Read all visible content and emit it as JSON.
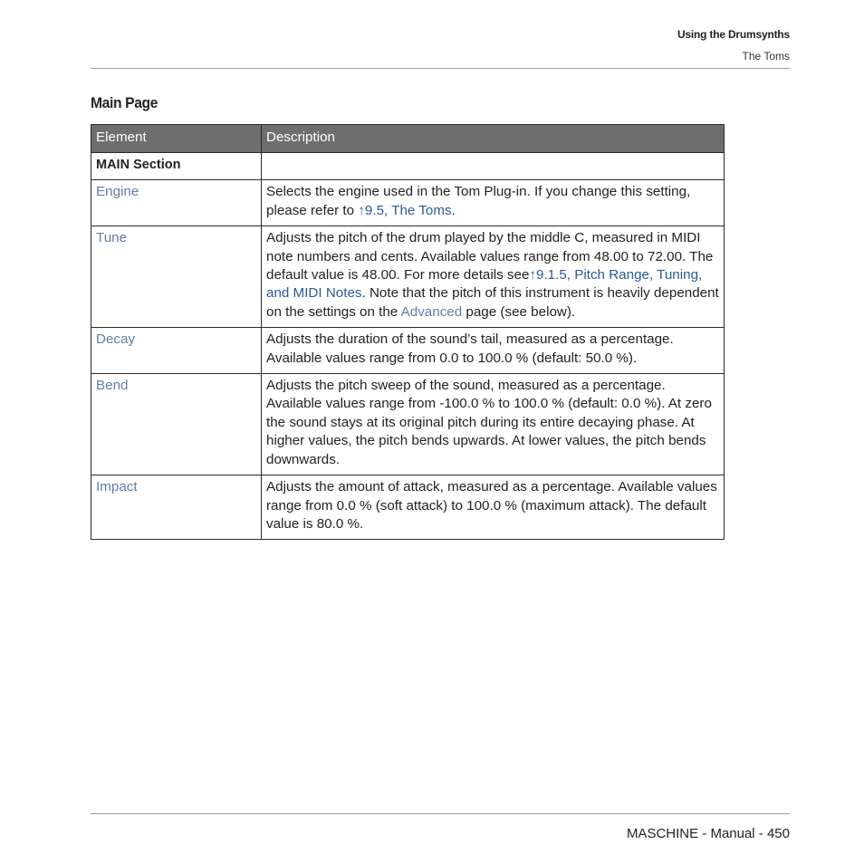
{
  "header": {
    "chapter": "Using the Drumsynths",
    "section": "The Toms"
  },
  "page_title": "Main Page",
  "table": {
    "columns": [
      "Element",
      "Description"
    ],
    "section_row": "MAIN Section",
    "rows": [
      {
        "element": "Engine",
        "desc_pre": "Selects the engine used in the Tom Plug-in. If you change this setting, please refer to ",
        "link": "↑9.5, The Toms",
        "desc_post": "."
      },
      {
        "element": "Tune",
        "desc_pre": "Adjusts the pitch of the drum played by the middle C, measured in MIDI note numbers and cents. Available values range from 48.00 to 72.00. The default value is 48.00. For more details see",
        "link": "↑9.1.5, Pitch Range, Tuning, and MIDI Notes",
        "desc_mid": ". Note that the pitch of this instrument is heavily dependent on the settings on the ",
        "link2": "Advanced",
        "desc_post": " page (see below)."
      },
      {
        "element": "Decay",
        "desc": "Adjusts the duration of the sound’s tail, measured as a percentage. Available values range from 0.0 to 100.0 % (default: 50.0 %)."
      },
      {
        "element": "Bend",
        "desc": "Adjusts the pitch sweep of the sound, measured as a percentage. Available values range from -100.0 % to 100.0 % (default: 0.0 %). At zero the sound stays at its original pitch during its entire decaying phase. At higher values, the pitch bends upwards. At lower values, the pitch bends downwards."
      },
      {
        "element": "Impact",
        "desc": "Adjusts the amount of attack, measured as a percentage. Available values range from 0.0 % (soft attack) to 100.0 % (maximum attack). The default value is 80.0 %."
      }
    ]
  },
  "footer": {
    "text": "MASCHINE - Manual - 450"
  },
  "colors": {
    "header_bg": "#6e6e6e",
    "element_name": "#5f7fa6",
    "link": "#2a5a98"
  }
}
